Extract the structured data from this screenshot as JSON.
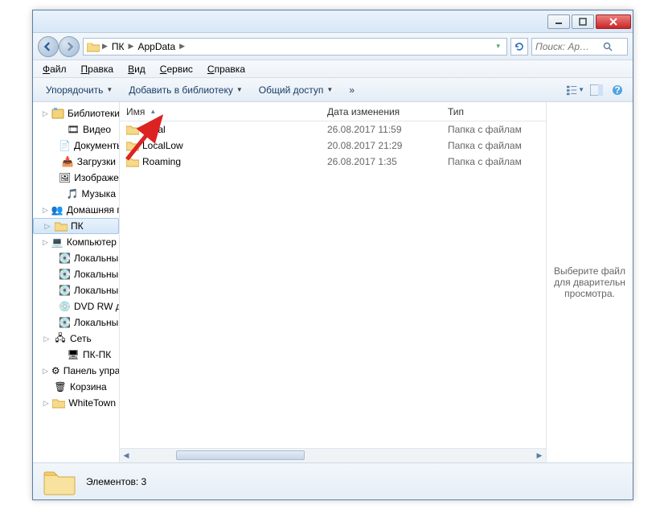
{
  "titlebar": {},
  "breadcrumb": {
    "seg1": "ПК",
    "seg2": "AppData"
  },
  "search": {
    "placeholder": "Поиск: Ap…"
  },
  "menu": {
    "file": "Файл",
    "edit": "Правка",
    "view": "Вид",
    "tools": "Сервис",
    "help": "Справка"
  },
  "toolbar": {
    "organize": "Упорядочить",
    "addlib": "Добавить в библиотеку",
    "share": "Общий доступ",
    "more": "»"
  },
  "tree": {
    "libraries": "Библиотеки",
    "video": "Видео",
    "docs": "Документы",
    "downloads": "Загрузки",
    "pictures": "Изображения",
    "music": "Музыка",
    "homegroup": "Домашняя группа",
    "pk": "ПК",
    "computer": "Компьютер",
    "ldC": "Локальный диск (C",
    "ldD": "Локальный диск (D",
    "ldE": "Локальный диск (E",
    "dvd": "DVD RW дисковод (",
    "ldY": "Локальный диск (Y",
    "network": "Сеть",
    "pkpk": "ПК-ПК",
    "cpanel": "Панель управления",
    "recycle": "Корзина",
    "whitetown": "WhiteTown"
  },
  "columns": {
    "name": "Имя",
    "date": "Дата изменения",
    "type": "Тип"
  },
  "rows": [
    {
      "name": "Local",
      "date": "26.08.2017 11:59",
      "type": "Папка с файлам"
    },
    {
      "name": "LocalLow",
      "date": "20.08.2017 21:29",
      "type": "Папка с файлам"
    },
    {
      "name": "Roaming",
      "date": "26.08.2017 1:35",
      "type": "Папка с файлам"
    }
  ],
  "preview": {
    "text": "Выберите файл для дварительн просмотра."
  },
  "status": {
    "count_label": "Элементов: 3"
  }
}
